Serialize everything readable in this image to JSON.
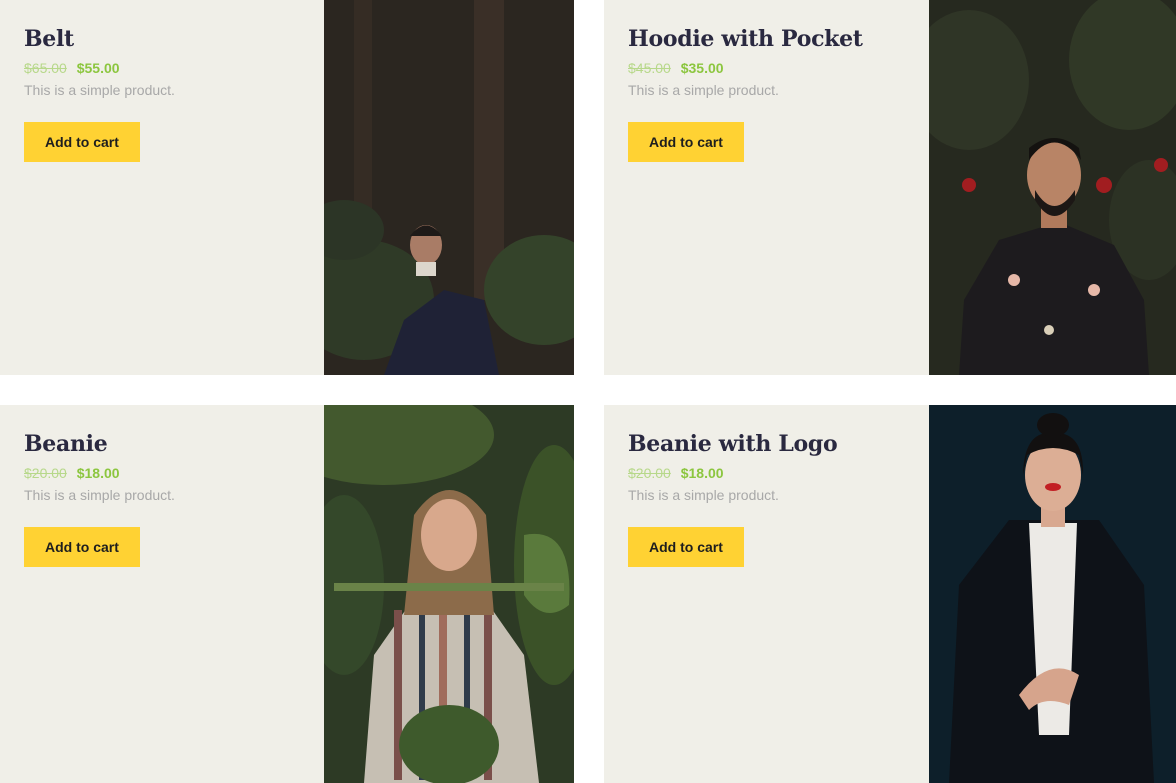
{
  "products": [
    {
      "title": "Belt",
      "old_price": "$65.00",
      "new_price": "$55.00",
      "description": "This is a simple product.",
      "button_label": "Add to cart",
      "image": "man-in-dark-forest-photo"
    },
    {
      "title": "Hoodie with Pocket",
      "old_price": "$45.00",
      "new_price": "$35.00",
      "description": "This is a simple product.",
      "button_label": "Add to cart",
      "image": "man-in-floral-shirt-photo"
    },
    {
      "title": "Beanie",
      "old_price": "$20.00",
      "new_price": "$18.00",
      "description": "This is a simple product.",
      "button_label": "Add to cart",
      "image": "woman-in-striped-sweater-photo"
    },
    {
      "title": "Beanie with Logo",
      "old_price": "$20.00",
      "new_price": "$18.00",
      "description": "This is a simple product.",
      "button_label": "Add to cart",
      "image": "woman-in-black-blazer-photo"
    }
  ],
  "colors": {
    "card_background": "#f0efe8",
    "title": "#2a2940",
    "old_price": "#b7d88a",
    "new_price": "#8cc63f",
    "description": "#a8a8a8",
    "button": "#ffd233"
  }
}
